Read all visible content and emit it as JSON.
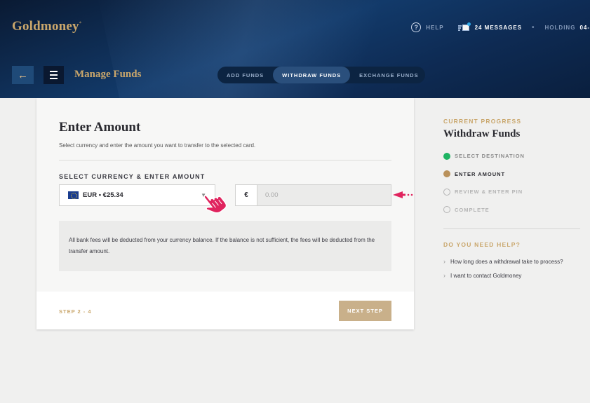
{
  "header": {
    "logo": "Goldmoney",
    "logo_mark": "*",
    "help": "HELP",
    "messages": "24 MESSAGES",
    "separator": "•",
    "holding_label": "HOLDING",
    "holding_value": "04-"
  },
  "subnav": {
    "title": "Manage Funds",
    "tabs": [
      {
        "label": "ADD FUNDS"
      },
      {
        "label": "WITHDRAW FUNDS"
      },
      {
        "label": "EXCHANGE FUNDS"
      }
    ],
    "active_tab": "WITHDRAW FUNDS"
  },
  "form": {
    "title": "Enter Amount",
    "subtitle": "Select currency and enter the amount you want to transfer to the selected card.",
    "section_label": "SELECT CURRENCY & ENTER AMOUNT",
    "currency_value": "EUR • €25.34",
    "currency_symbol": "€",
    "amount_placeholder": "0.00",
    "info": "All bank fees will be deducted from your currency balance. If the balance is not sufficient, the fees will be deducted from the transfer amount.",
    "step": "STEP 2 - 4",
    "next_button": "NEXT STEP"
  },
  "progress": {
    "label": "CURRENT PROGRESS",
    "title": "Withdraw Funds",
    "steps": [
      {
        "label": "SELECT DESTINATION",
        "state": "done"
      },
      {
        "label": "ENTER AMOUNT",
        "state": "current"
      },
      {
        "label": "REVIEW & ENTER PIN",
        "state": "todo"
      },
      {
        "label": "COMPLETE",
        "state": "todo"
      }
    ]
  },
  "help": {
    "label": "DO YOU NEED HELP?",
    "links": [
      {
        "label": "How long does a withdrawal take to process?"
      },
      {
        "label": "I want to contact Goldmoney"
      }
    ]
  },
  "colors": {
    "gold": "#c9a66b",
    "navy": "#0e2b54",
    "done_green": "#1fb463",
    "current_brown": "#b9915b",
    "annotation_pink": "#e0245e"
  },
  "icons": [
    "help-icon",
    "messages-icon",
    "back-arrow-icon",
    "menu-icon",
    "eu-flag-icon",
    "chevron-down-icon",
    "pointer-hand-icon",
    "annotation-arrow-icon",
    "chevron-right-icon"
  ]
}
